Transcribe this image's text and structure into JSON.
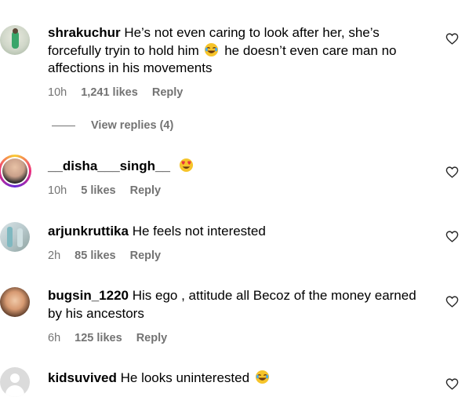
{
  "comments": [
    {
      "username": "shrakuchur",
      "text_before": "He’s not even caring to look after her, she’s forcefully tryin to hold him",
      "text_after": "he doesn’t even care man no affections in his movements",
      "time": "10h",
      "likes": "1,241 likes",
      "reply": "Reply"
    },
    {
      "username": "__disha___singh__",
      "text_before": "",
      "text_after": "",
      "time": "10h",
      "likes": "5 likes",
      "reply": "Reply"
    },
    {
      "username": "arjunkruttika",
      "text_before": "He feels not interested",
      "text_after": "",
      "time": "2h",
      "likes": "85 likes",
      "reply": "Reply"
    },
    {
      "username": "bugsin_1220",
      "text_before": "His ego , attitude all Becoz of the money earned by his ancestors",
      "text_after": "",
      "time": "6h",
      "likes": "125 likes",
      "reply": "Reply"
    },
    {
      "username": "kidsuvived",
      "text_before": "He looks uninterested",
      "text_after": "",
      "time": "",
      "likes": "",
      "reply": ""
    }
  ],
  "view_replies": "View replies (4)",
  "icons": {
    "like": "heart-outline-icon",
    "laugh": "joy-emoji",
    "love": "heart-eyes-emoji"
  }
}
